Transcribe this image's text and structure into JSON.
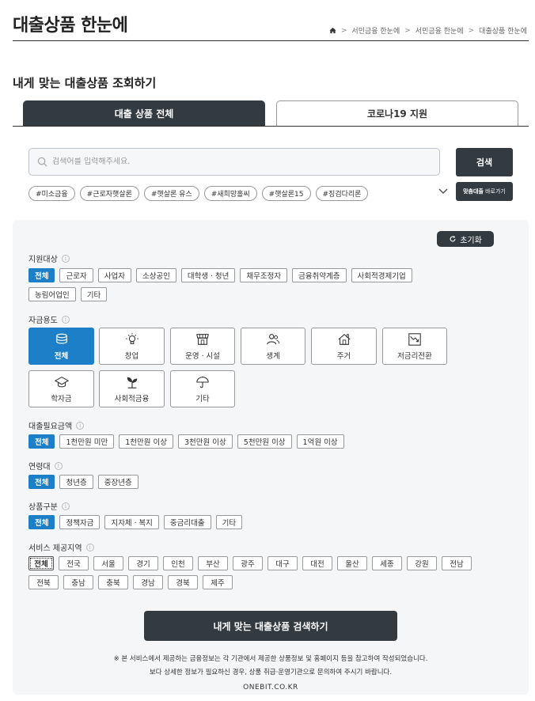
{
  "header": {
    "title": "대출상품 한눈에",
    "breadcrumb": [
      "서민금융 한눈에",
      "서민금융 한눈에",
      "대출상품 한눈에"
    ]
  },
  "section_title": "내게 맞는 대출상품 조회하기",
  "tabs": [
    {
      "label": "대출 상품 전체",
      "active": true
    },
    {
      "label": "코로나19 지원",
      "active": false
    }
  ],
  "search": {
    "placeholder": "검색어를 입력해주세요.",
    "value": "",
    "button_label": "검색"
  },
  "hashtags": [
    "#미소금융",
    "#근로자햇살론",
    "#햇살론 유스",
    "#새희망홀씨",
    "#햇살론15",
    "#징검다리론"
  ],
  "shortcut": {
    "highlight": "맞춤대출",
    "label": "바로가기"
  },
  "filters": {
    "reset_label": "초기화",
    "target": {
      "label": "지원대상",
      "options": [
        "전체",
        "근로자",
        "사업자",
        "소상공인",
        "대학생ㆍ청년",
        "채무조정자",
        "금융취약계층",
        "사회적경제기업",
        "농림어업인",
        "기타"
      ],
      "selected": "전체"
    },
    "purpose": {
      "label": "자금용도",
      "options": [
        {
          "label": "전체",
          "icon": "coins-icon"
        },
        {
          "label": "창업",
          "icon": "lightbulb-icon"
        },
        {
          "label": "운영ㆍ시설",
          "icon": "storefront-icon"
        },
        {
          "label": "생계",
          "icon": "people-icon"
        },
        {
          "label": "주거",
          "icon": "house-icon"
        },
        {
          "label": "저금리전환",
          "icon": "trend-down-icon"
        },
        {
          "label": "학자금",
          "icon": "graduation-cap-icon"
        },
        {
          "label": "사회적금융",
          "icon": "sprout-icon"
        },
        {
          "label": "기타",
          "icon": "umbrella-icon"
        }
      ],
      "selected": "전체"
    },
    "amount": {
      "label": "대출필요금액",
      "options": [
        "전체",
        "1천만원 미만",
        "1천만원 이상",
        "3천만원 이상",
        "5천만원 이상",
        "1억원 이상"
      ],
      "selected": "전체"
    },
    "age": {
      "label": "연령대",
      "options": [
        "전체",
        "청년층",
        "중장년층"
      ],
      "selected": "전체"
    },
    "category": {
      "label": "상품구분",
      "options": [
        "전체",
        "정책자금",
        "지자체ㆍ복지",
        "중금리대출",
        "기타"
      ],
      "selected": "전체"
    },
    "region": {
      "label": "서비스 제공지역",
      "options": [
        "전체",
        "전국",
        "서울",
        "경기",
        "인천",
        "부산",
        "광주",
        "대구",
        "대전",
        "울산",
        "세종",
        "강원",
        "전남",
        "전북",
        "충남",
        "충북",
        "경남",
        "경북",
        "제주"
      ],
      "selected": "전체"
    }
  },
  "submit_label": "내게 맞는 대출상품 검색하기",
  "notice": [
    "※ 본 서비스에서 제공하는 금융정보는 각 기관에서 제공한 상품정보 및 홈페이지 등을 참고하여 작성되었습니다.",
    "보다 상세한 정보가 필요하신 경우, 상품 취급·운영기관으로 문의하여 주시기 바랍니다."
  ],
  "footer": "ONEBIT.CO.KR",
  "colors": {
    "dark": "#333a40",
    "accent": "#1c7fc7",
    "panel": "#f5f6f8"
  }
}
